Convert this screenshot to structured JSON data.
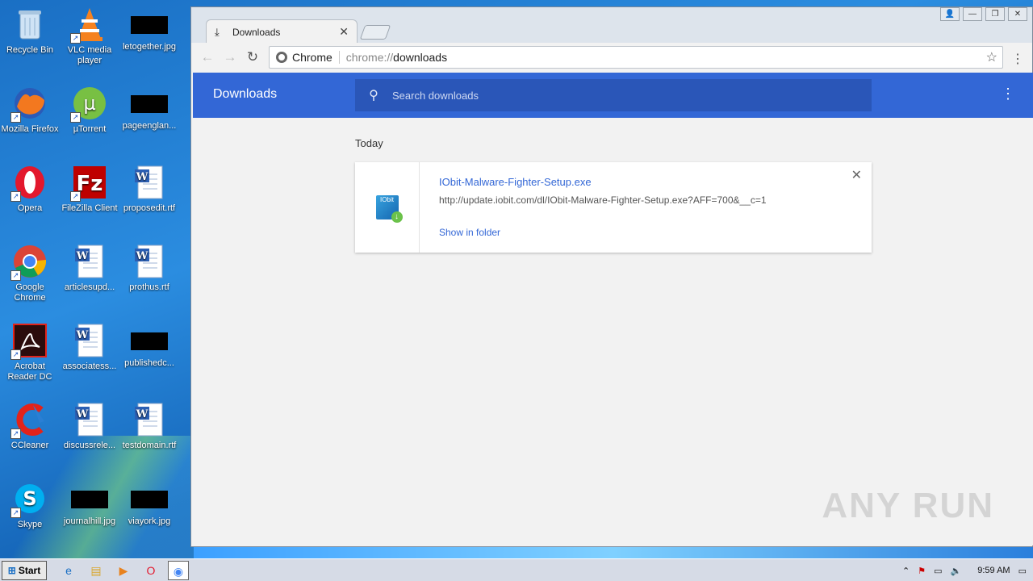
{
  "desktop": {
    "icons": [
      {
        "label": "Recycle Bin",
        "glyph": "recycle-bin-icon"
      },
      {
        "label": "VLC media player",
        "glyph": "vlc-icon"
      },
      {
        "label": "letogether.jpg",
        "glyph": "image-file-icon"
      },
      {
        "label": "Mozilla Firefox",
        "glyph": "firefox-icon"
      },
      {
        "label": "µTorrent",
        "glyph": "utorrent-icon"
      },
      {
        "label": "pageenglan...",
        "glyph": "image-file-icon"
      },
      {
        "label": "Opera",
        "glyph": "opera-icon"
      },
      {
        "label": "FileZilla Client",
        "glyph": "filezilla-icon"
      },
      {
        "label": "proposedit.rtf",
        "glyph": "word-doc-icon"
      },
      {
        "label": "Google Chrome",
        "glyph": "chrome-icon"
      },
      {
        "label": "articlesupd...",
        "glyph": "word-doc-icon"
      },
      {
        "label": "prothus.rtf",
        "glyph": "word-doc-icon"
      },
      {
        "label": "Acrobat Reader DC",
        "glyph": "acrobat-icon"
      },
      {
        "label": "associatess...",
        "glyph": "word-doc-icon"
      },
      {
        "label": "publishedc...",
        "glyph": "image-file-icon"
      },
      {
        "label": "CCleaner",
        "glyph": "ccleaner-icon"
      },
      {
        "label": "discussrele...",
        "glyph": "word-doc-icon"
      },
      {
        "label": "testdomain.rtf",
        "glyph": "word-doc-icon"
      },
      {
        "label": "Skype",
        "glyph": "skype-icon"
      },
      {
        "label": "journalhill.jpg",
        "glyph": "image-file-icon"
      },
      {
        "label": "viayork.jpg",
        "glyph": "image-file-icon"
      }
    ]
  },
  "browser": {
    "tab_title": "Downloads",
    "address": {
      "site": "Chrome",
      "scheme": "chrome://",
      "path": "downloads"
    },
    "page": {
      "heading": "Downloads",
      "search_placeholder": "Search downloads",
      "section_label": "Today",
      "download": {
        "filename": "IObit-Malware-Fighter-Setup.exe",
        "url": "http://update.iobit.com/dl/IObit-Malware-Fighter-Setup.exe?AFF=700&__c=1",
        "action": "Show in folder",
        "icon_text": "IObit"
      }
    }
  },
  "watermark": "ANY RUN",
  "taskbar": {
    "start_label": "Start",
    "clock": "9:59 AM"
  }
}
